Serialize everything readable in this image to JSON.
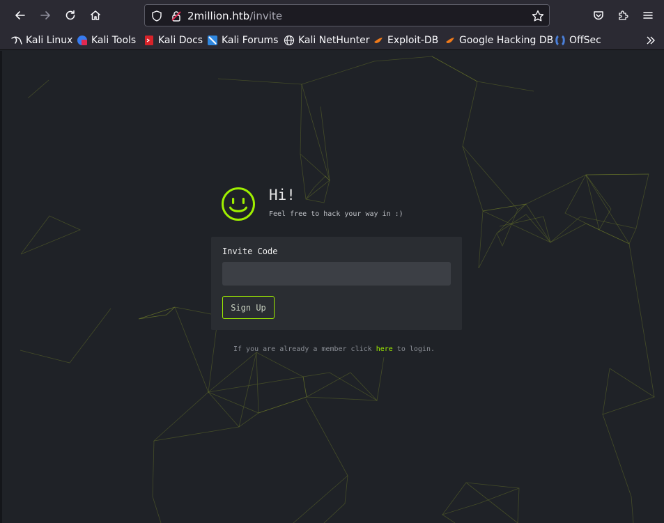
{
  "browser": {
    "url_host": "2million.htb",
    "url_path": "/invite",
    "bookmarks": [
      {
        "label": "Kali Linux",
        "icon": "kali-dragon-icon"
      },
      {
        "label": "Kali Tools",
        "icon": "kali-tools-icon"
      },
      {
        "label": "Kali Docs",
        "icon": "kali-docs-icon"
      },
      {
        "label": "Kali Forums",
        "icon": "kali-forums-icon"
      },
      {
        "label": "Kali NetHunter",
        "icon": "globe-icon"
      },
      {
        "label": "Exploit-DB",
        "icon": "exploit-db-icon"
      },
      {
        "label": "Google Hacking DB",
        "icon": "ghdb-icon"
      },
      {
        "label": "OffSec",
        "icon": "offsec-icon"
      }
    ]
  },
  "hero": {
    "title": "Hi!",
    "tagline": "Feel free to hack your way in :)"
  },
  "form": {
    "label": "Invite Code",
    "input_value": "",
    "input_placeholder": "",
    "button_label": "Sign Up"
  },
  "footer": {
    "prefix": "If you are already a member click ",
    "link": "here",
    "suffix": " to login."
  },
  "colors": {
    "accent": "#9fef00",
    "background": "#1f2227",
    "card": "#2a2d32",
    "input": "#3c3f45"
  }
}
